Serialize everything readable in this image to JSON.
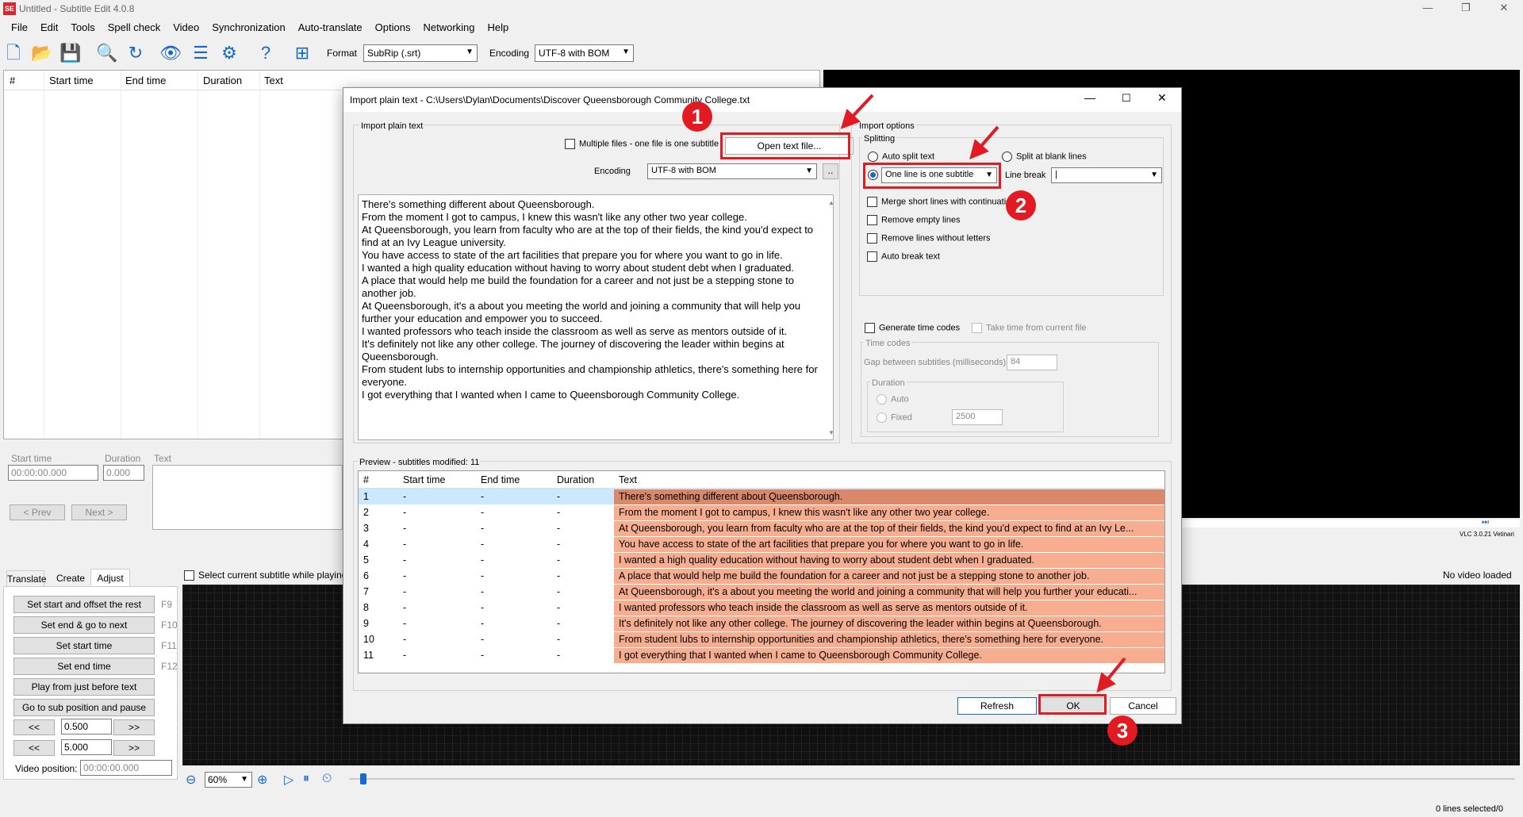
{
  "app": {
    "title": "Untitled - Subtitle Edit 4.0.8",
    "icon": "SE"
  },
  "menu": [
    "File",
    "Edit",
    "Tools",
    "Spell check",
    "Video",
    "Synchronization",
    "Auto-translate",
    "Options",
    "Networking",
    "Help"
  ],
  "toolbar": {
    "format_label": "Format",
    "format_value": "SubRip (.srt)",
    "encoding_label": "Encoding",
    "encoding_value": "UTF-8 with BOM"
  },
  "main_grid": {
    "headers": [
      "#",
      "Start time",
      "End time",
      "Duration",
      "Text"
    ]
  },
  "edit": {
    "start_label": "Start time",
    "start_value": "00:00:00.000",
    "duration_label": "Duration",
    "duration_value": "0.000",
    "text_label": "Text",
    "prev": "< Prev",
    "next": "Next >"
  },
  "tabs": [
    "Translate",
    "Create",
    "Adjust"
  ],
  "adjust": {
    "buttons": [
      {
        "label": "Set start and offset the rest",
        "key": "F9"
      },
      {
        "label": "Set end & go to next",
        "key": "F10"
      },
      {
        "label": "Set start time",
        "key": "F11"
      },
      {
        "label": "Set end time",
        "key": "F12"
      },
      {
        "label": "Play from just before text",
        "key": ""
      },
      {
        "label": "Go to sub position and pause",
        "key": ""
      }
    ],
    "back": "<<",
    "fwd": ">>",
    "val1": "0.500",
    "val2": "5.000",
    "video_pos_label": "Video position:",
    "video_pos_value": "00:00:00.000"
  },
  "video": {
    "select_current": "Select current subtitle while playing",
    "no_video": "No video loaded",
    "vlc": "VLC 3.0.21 Vetinari",
    "zoom": "60%"
  },
  "status": {
    "lines_selected": "0 lines selected/0"
  },
  "dialog": {
    "title": "Import plain text - C:\\Users\\Dylan\\Documents\\Discover Queensborough Community College.txt",
    "import_group": "Import plain text",
    "multiple_files": "Multiple files - one file is one subtitle",
    "open_file": "Open text file...",
    "encoding_label": "Encoding",
    "encoding_value": "UTF-8 with BOM",
    "ellipsis": "..",
    "text_lines": [
      "There's something different about Queensborough.",
      "From the moment I got to campus, I knew this wasn't like any other two year college.",
      "At Queensborough, you learn from faculty who are at the top of their fields, the kind you'd expect to",
      "find at an Ivy League university.",
      "You have access to state of the art facilities that prepare you for where you want to go in life.",
      "I wanted a high quality education without having to worry about student debt when I graduated.",
      "A place that would help me build the foundation for a career and not just be a stepping stone to",
      "another job.",
      "At Queensborough, it's a about you meeting the world and joining a community that will help you",
      "further your education and empower you to succeed.",
      "I wanted professors who teach inside the classroom as well as serve as mentors outside of it.",
      "It's definitely not like any other college. The journey of discovering the leader within begins at",
      "Queensborough.",
      "From student lubs to internship opportunities and championship athletics, there's something here for",
      "everyone.",
      "I got everything that I wanted when I came to Queensborough Community College."
    ],
    "options_group": "Import options",
    "splitting": "Splitting",
    "auto_split": "Auto split text",
    "split_blank": "Split at blank lines",
    "split_mode": "One line is one subtitle",
    "line_break_label": "Line break",
    "line_break_value": "|",
    "merge_short": "Merge short lines with continuation",
    "remove_empty": "Remove empty lines",
    "remove_no_letters": "Remove lines without letters",
    "auto_break": "Auto break text",
    "gen_timecodes": "Generate time codes",
    "take_time": "Take time from current file",
    "time_codes": "Time codes",
    "gap_label": "Gap between subtitles (milliseconds)",
    "gap_value": "84",
    "duration_group": "Duration",
    "auto": "Auto",
    "fixed": "Fixed",
    "fixed_value": "2500",
    "preview_label": "Preview - subtitles modified: 11",
    "preview_headers": [
      "#",
      "Start time",
      "End time",
      "Duration",
      "Text"
    ],
    "preview_rows": [
      [
        "1",
        "-",
        "-",
        "-",
        "There's something different about Queensborough."
      ],
      [
        "2",
        "-",
        "-",
        "-",
        "From the moment I got to campus, I knew this wasn't like any other two year college."
      ],
      [
        "3",
        "-",
        "-",
        "-",
        "At Queensborough, you learn from faculty who are at the top of their fields, the kind you'd expect to find at an Ivy Le..."
      ],
      [
        "4",
        "-",
        "-",
        "-",
        "You have access to state of the art facilities that prepare you for where you want to go in life."
      ],
      [
        "5",
        "-",
        "-",
        "-",
        "I wanted a high quality education without having to worry about student debt when I graduated."
      ],
      [
        "6",
        "-",
        "-",
        "-",
        "A place that would help me build the foundation for a career and not just be a stepping stone to another job."
      ],
      [
        "7",
        "-",
        "-",
        "-",
        "At Queensborough, it's a about you meeting the world and joining a community that will help you further your educati..."
      ],
      [
        "8",
        "-",
        "-",
        "-",
        "I wanted professors who teach inside the classroom as well as serve as mentors outside of it."
      ],
      [
        "9",
        "-",
        "-",
        "-",
        "It's definitely not like any other college. The journey of discovering the leader within begins at Queensborough."
      ],
      [
        "10",
        "-",
        "-",
        "-",
        "From student lubs to internship opportunities and championship athletics, there's something here for everyone."
      ],
      [
        "11",
        "-",
        "-",
        "-",
        "I got everything that I wanted when I came to Queensborough Community College."
      ]
    ],
    "refresh": "Refresh",
    "ok": "OK",
    "cancel": "Cancel"
  },
  "annotations": [
    "1",
    "2",
    "3"
  ],
  "colors": {
    "highlight": "#e21a22",
    "row_text_bg": "#f7ad8f",
    "row_selected_text_bg": "#d9886a",
    "selected_row": "#cce8ff"
  }
}
